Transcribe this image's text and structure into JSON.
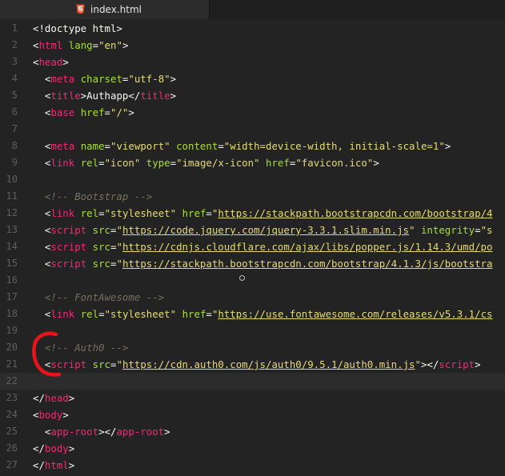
{
  "tab": {
    "filename": "index.html",
    "icon": "html5-icon"
  },
  "active_line": 22,
  "lines": [
    {
      "num": "1",
      "tokens": [
        [
          "p",
          "<!doctype html>"
        ]
      ]
    },
    {
      "num": "2",
      "tokens": [
        [
          "p",
          "<"
        ],
        [
          "t",
          "html"
        ],
        [
          "p",
          " "
        ],
        [
          "a",
          "lang"
        ],
        [
          "p",
          "="
        ],
        [
          "s",
          "\"en\""
        ],
        [
          "p",
          ">"
        ]
      ]
    },
    {
      "num": "3",
      "tokens": [
        [
          "p",
          "<"
        ],
        [
          "t",
          "head"
        ],
        [
          "p",
          ">"
        ]
      ]
    },
    {
      "num": "4",
      "tokens": [
        [
          "p",
          "  <"
        ],
        [
          "t",
          "meta"
        ],
        [
          "p",
          " "
        ],
        [
          "a",
          "charset"
        ],
        [
          "p",
          "="
        ],
        [
          "s",
          "\"utf-8\""
        ],
        [
          "p",
          ">"
        ]
      ]
    },
    {
      "num": "5",
      "tokens": [
        [
          "p",
          "  <"
        ],
        [
          "t",
          "title"
        ],
        [
          "p",
          ">Authapp</"
        ],
        [
          "t",
          "title"
        ],
        [
          "p",
          ">"
        ]
      ]
    },
    {
      "num": "6",
      "tokens": [
        [
          "p",
          "  <"
        ],
        [
          "t",
          "base"
        ],
        [
          "p",
          " "
        ],
        [
          "a",
          "href"
        ],
        [
          "p",
          "="
        ],
        [
          "s",
          "\"/\""
        ],
        [
          "p",
          ">"
        ]
      ]
    },
    {
      "num": "7",
      "tokens": []
    },
    {
      "num": "8",
      "tokens": [
        [
          "p",
          "  <"
        ],
        [
          "t",
          "meta"
        ],
        [
          "p",
          " "
        ],
        [
          "a",
          "name"
        ],
        [
          "p",
          "="
        ],
        [
          "s",
          "\"viewport\""
        ],
        [
          "p",
          " "
        ],
        [
          "a",
          "content"
        ],
        [
          "p",
          "="
        ],
        [
          "s",
          "\"width=device-width, initial-scale=1\""
        ],
        [
          "p",
          ">"
        ]
      ]
    },
    {
      "num": "9",
      "tokens": [
        [
          "p",
          "  <"
        ],
        [
          "t",
          "link"
        ],
        [
          "p",
          " "
        ],
        [
          "a",
          "rel"
        ],
        [
          "p",
          "="
        ],
        [
          "s",
          "\"icon\""
        ],
        [
          "p",
          " "
        ],
        [
          "a",
          "type"
        ],
        [
          "p",
          "="
        ],
        [
          "s",
          "\"image/x-icon\""
        ],
        [
          "p",
          " "
        ],
        [
          "a",
          "href"
        ],
        [
          "p",
          "="
        ],
        [
          "s",
          "\"favicon.ico\""
        ],
        [
          "p",
          ">"
        ]
      ]
    },
    {
      "num": "10",
      "tokens": []
    },
    {
      "num": "11",
      "tokens": [
        [
          "c",
          "  <!-- Bootstrap -->"
        ]
      ]
    },
    {
      "num": "12",
      "tokens": [
        [
          "p",
          "  <"
        ],
        [
          "t",
          "link"
        ],
        [
          "p",
          " "
        ],
        [
          "a",
          "rel"
        ],
        [
          "p",
          "="
        ],
        [
          "s",
          "\"stylesheet\""
        ],
        [
          "p",
          " "
        ],
        [
          "a",
          "href"
        ],
        [
          "p",
          "="
        ],
        [
          "s",
          "\""
        ],
        [
          "l",
          "https://stackpath.bootstrapcdn.com/bootstrap/4"
        ]
      ]
    },
    {
      "num": "13",
      "tokens": [
        [
          "p",
          "  <"
        ],
        [
          "t",
          "script"
        ],
        [
          "p",
          " "
        ],
        [
          "a",
          "src"
        ],
        [
          "p",
          "="
        ],
        [
          "s",
          "\""
        ],
        [
          "l",
          "https://code.jquery.com/jquery-3.3.1.slim.min.js"
        ],
        [
          "s",
          "\""
        ],
        [
          "p",
          " "
        ],
        [
          "a",
          "integrity"
        ],
        [
          "p",
          "="
        ],
        [
          "s",
          "\"s"
        ]
      ]
    },
    {
      "num": "14",
      "tokens": [
        [
          "p",
          "  <"
        ],
        [
          "t",
          "script"
        ],
        [
          "p",
          " "
        ],
        [
          "a",
          "src"
        ],
        [
          "p",
          "="
        ],
        [
          "s",
          "\""
        ],
        [
          "l",
          "https://cdnjs.cloudflare.com/ajax/libs/popper.js/1.14.3/umd/po"
        ]
      ]
    },
    {
      "num": "15",
      "tokens": [
        [
          "p",
          "  <"
        ],
        [
          "t",
          "script"
        ],
        [
          "p",
          " "
        ],
        [
          "a",
          "src"
        ],
        [
          "p",
          "="
        ],
        [
          "s",
          "\""
        ],
        [
          "l",
          "https://stackpath.bootstrapcdn.com/bootstrap/4.1.3/js/bootstra"
        ]
      ]
    },
    {
      "num": "16",
      "tokens": []
    },
    {
      "num": "17",
      "tokens": [
        [
          "c",
          "  <!-- FontAwesome -->"
        ]
      ]
    },
    {
      "num": "18",
      "tokens": [
        [
          "p",
          "  <"
        ],
        [
          "t",
          "link"
        ],
        [
          "p",
          " "
        ],
        [
          "a",
          "rel"
        ],
        [
          "p",
          "="
        ],
        [
          "s",
          "\"stylesheet\""
        ],
        [
          "p",
          " "
        ],
        [
          "a",
          "href"
        ],
        [
          "p",
          "="
        ],
        [
          "s",
          "\""
        ],
        [
          "l",
          "https://use.fontawesome.com/releases/v5.3.1/cs"
        ]
      ]
    },
    {
      "num": "19",
      "tokens": []
    },
    {
      "num": "20",
      "tokens": [
        [
          "c",
          "  <!-- Auth0 -->"
        ]
      ]
    },
    {
      "num": "21",
      "tokens": [
        [
          "p",
          "  <"
        ],
        [
          "t",
          "script"
        ],
        [
          "p",
          " "
        ],
        [
          "a",
          "src"
        ],
        [
          "p",
          "="
        ],
        [
          "s",
          "\""
        ],
        [
          "l",
          "https://cdn.auth0.com/js/auth0/9.5.1/auth0.min.js"
        ],
        [
          "s",
          "\""
        ],
        [
          "p",
          "></"
        ],
        [
          "t",
          "script"
        ],
        [
          "p",
          ">"
        ]
      ]
    },
    {
      "num": "22",
      "tokens": []
    },
    {
      "num": "23",
      "tokens": [
        [
          "p",
          "</"
        ],
        [
          "t",
          "head"
        ],
        [
          "p",
          ">"
        ]
      ]
    },
    {
      "num": "24",
      "tokens": [
        [
          "p",
          "<"
        ],
        [
          "t",
          "body"
        ],
        [
          "p",
          ">"
        ]
      ]
    },
    {
      "num": "25",
      "tokens": [
        [
          "p",
          "  <"
        ],
        [
          "t",
          "app-root"
        ],
        [
          "p",
          "></"
        ],
        [
          "t",
          "app-root"
        ],
        [
          "p",
          ">"
        ]
      ]
    },
    {
      "num": "26",
      "tokens": [
        [
          "p",
          "</"
        ],
        [
          "t",
          "body"
        ],
        [
          "p",
          ">"
        ]
      ]
    },
    {
      "num": "27",
      "tokens": [
        [
          "p",
          "</"
        ],
        [
          "t",
          "html"
        ],
        [
          "p",
          ">"
        ]
      ]
    }
  ],
  "colors": {
    "background": "#232323",
    "tag": "#f92672",
    "attribute": "#a6e22e",
    "string": "#e6db74",
    "comment": "#75715e",
    "annotation": "#e8141b"
  }
}
